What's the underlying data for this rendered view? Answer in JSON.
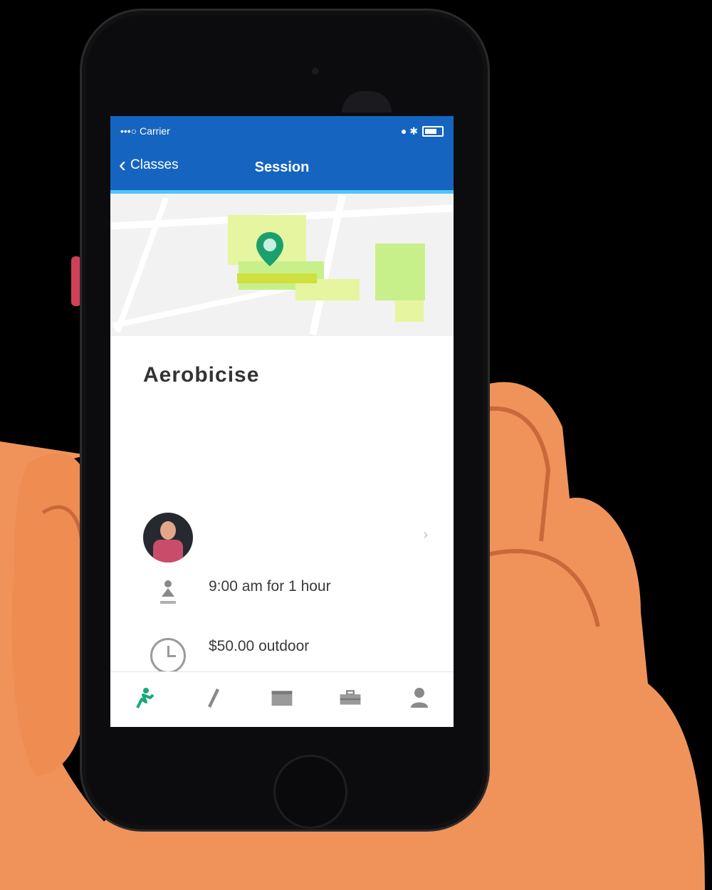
{
  "status_bar": {
    "carrier": "•••○ Carrier",
    "time": "",
    "right_text": "● ✱"
  },
  "nav": {
    "back_label": "Classes",
    "title": "Session"
  },
  "activity": {
    "title": "Aerobicise",
    "subtitle": "",
    "description": ""
  },
  "instructor": {
    "name": "",
    "detail": ""
  },
  "schedule": {
    "time": "9:00 am for 1 hour",
    "detail": ""
  },
  "location": {
    "price": "$50.00 outdoor",
    "detail": ""
  },
  "tabs": [
    {
      "label": "",
      "icon": "activity-icon",
      "active": true
    },
    {
      "label": "",
      "icon": "pencil-icon",
      "active": false
    },
    {
      "label": "",
      "icon": "calendar-icon",
      "active": false
    },
    {
      "label": "",
      "icon": "briefcase-icon",
      "active": false
    },
    {
      "label": "",
      "icon": "profile-icon",
      "active": false
    }
  ],
  "colors": {
    "nav": "#1565c0",
    "accent": "#4fc3f7",
    "link": "#3cc9a6",
    "pin": "#1aa06e",
    "park": "#c8f08a"
  }
}
